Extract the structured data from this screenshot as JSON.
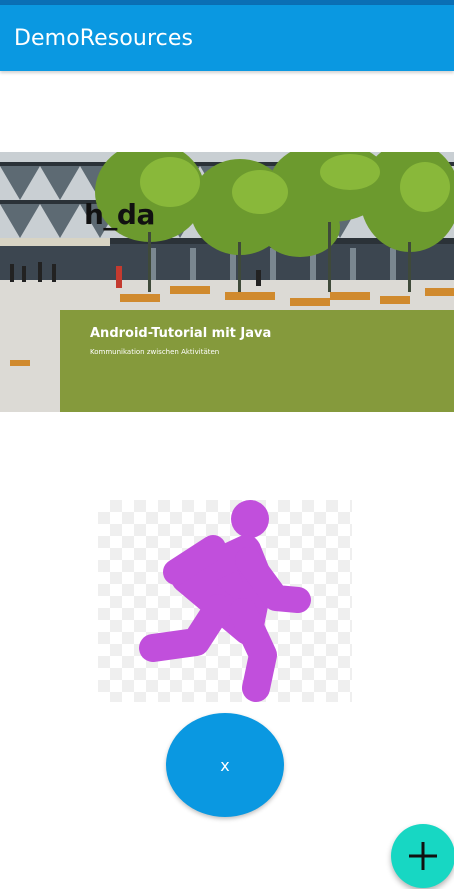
{
  "colors": {
    "status_bar": "#0A6FB5",
    "app_bar": "#0A98E1",
    "accent_fab": "#17D7C3",
    "runner_icon": "#C14FDC",
    "banner_overlay": "#7E9430"
  },
  "app_bar": {
    "title": "DemoResources"
  },
  "banner": {
    "logo_text": "h_da",
    "title": "Android-Tutorial mit Java",
    "subtitle": "Kommunikation zwischen Aktivitäten"
  },
  "runner": {
    "icon": "directions-run-icon"
  },
  "oval_button": {
    "label": "x"
  },
  "fab": {
    "icon": "plus-icon"
  }
}
